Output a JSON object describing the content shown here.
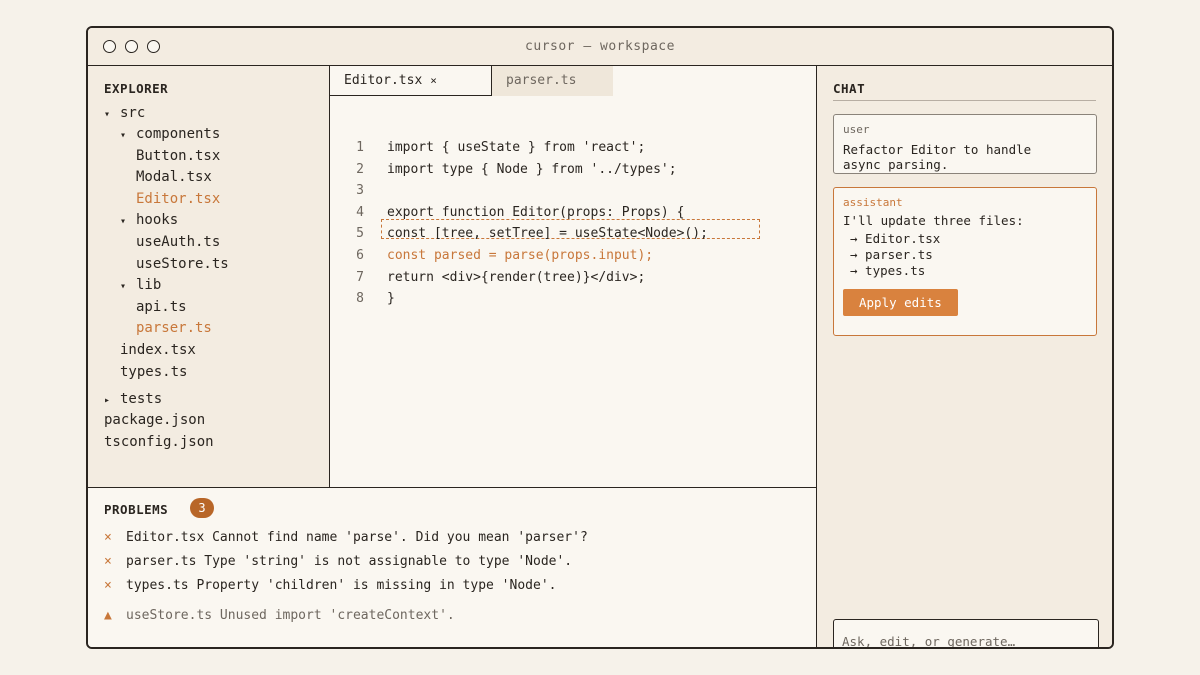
{
  "window": {
    "title": "cursor — workspace"
  },
  "explorer": {
    "heading": "EXPLORER",
    "items": [
      {
        "label": "src",
        "arrow": "▾"
      },
      {
        "label": "components",
        "arrow": "▾"
      },
      {
        "label": "Button.tsx"
      },
      {
        "label": "Modal.tsx"
      },
      {
        "label": "Editor.tsx",
        "highlighted": true
      },
      {
        "label": "hooks",
        "arrow": "▾"
      },
      {
        "label": "useAuth.ts"
      },
      {
        "label": "useStore.ts"
      },
      {
        "label": "lib",
        "arrow": "▾"
      },
      {
        "label": "api.ts"
      },
      {
        "label": "parser.ts",
        "highlighted": true
      },
      {
        "label": "index.tsx"
      },
      {
        "label": "types.ts"
      },
      {
        "label": "tests",
        "arrow": "▸"
      },
      {
        "label": "package.json"
      },
      {
        "label": "tsconfig.json"
      }
    ]
  },
  "editor": {
    "tabs": [
      {
        "label": "Editor.tsx",
        "close": "×",
        "active": true
      },
      {
        "label": "parser.ts"
      }
    ],
    "lines": [
      {
        "num": "1",
        "text": "import { useState } from 'react';"
      },
      {
        "num": "2",
        "text": "import type { Node } from '../types';"
      },
      {
        "num": "3",
        "text": ""
      },
      {
        "num": "4",
        "text": "export function Editor(props: Props) {"
      },
      {
        "num": "5",
        "text": "const [tree, setTree] = useState<Node>();"
      },
      {
        "num": "6",
        "text": "const parsed = parse(props.input);",
        "highlighted": true
      },
      {
        "num": "7",
        "text": "return <div>{render(tree)}</div>;"
      },
      {
        "num": "8",
        "text": "}"
      }
    ]
  },
  "problems": {
    "heading": "PROBLEMS",
    "count": "3",
    "items": [
      {
        "mark": "×",
        "text": "Editor.tsx Cannot find name 'parse'. Did you mean 'parser'?"
      },
      {
        "mark": "×",
        "text": "parser.ts Type 'string' is not assignable to type 'Node'."
      },
      {
        "mark": "×",
        "text": "types.ts Property 'children' is missing in type 'Node'."
      },
      {
        "mark": "▲",
        "text": "useStore.ts Unused import 'createContext'.",
        "warning": true
      }
    ]
  },
  "chat": {
    "heading": "CHAT",
    "user": {
      "role": "user",
      "lines": [
        "Refactor Editor to handle",
        "async parsing."
      ]
    },
    "assistant": {
      "role": "assistant",
      "intro": "I'll update three files:",
      "files": [
        "→ Editor.tsx",
        "→ parser.ts",
        "→ types.ts"
      ],
      "button": "Apply edits"
    },
    "input_placeholder": "Ask, edit, or generate…"
  },
  "colors": {
    "accent": "#c8773a",
    "badge": "#b86628",
    "button": "#d9823e",
    "border": "#2a2520"
  }
}
